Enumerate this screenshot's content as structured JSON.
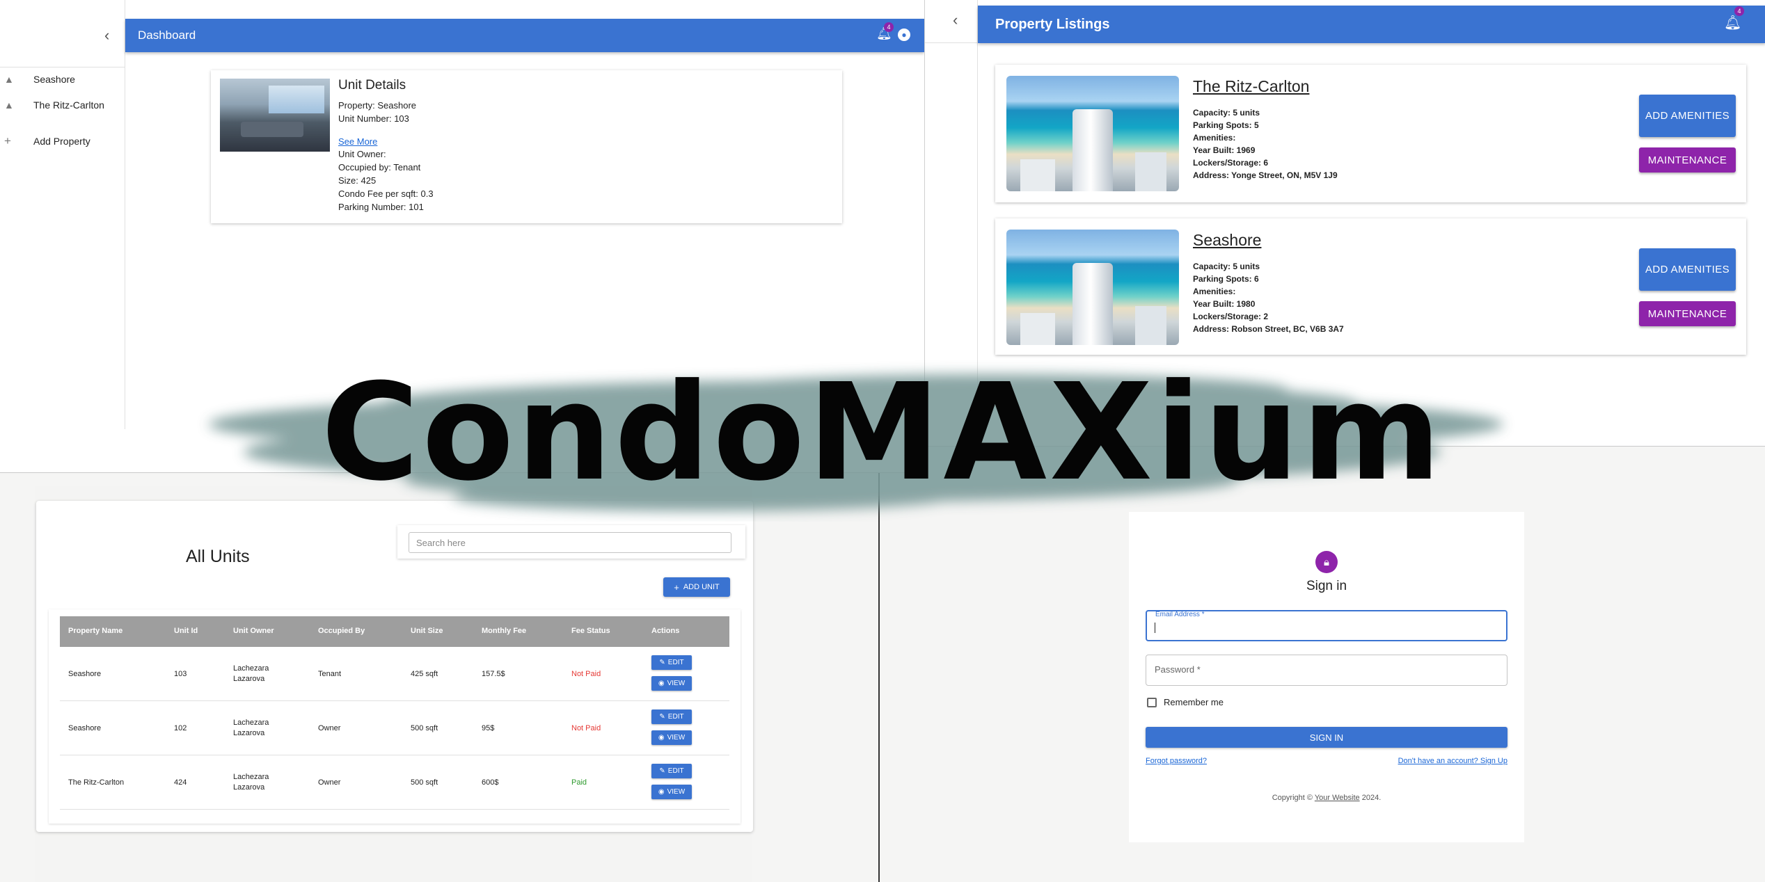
{
  "dashboard": {
    "drawer_items": [
      {
        "label": "Seashore",
        "icon": "buildings-icon"
      },
      {
        "label": "The Ritz-Carlton",
        "icon": "buildings-icon"
      },
      {
        "label": "Add Property",
        "icon": "plus-icon"
      }
    ],
    "title": "Dashboard",
    "notification_count": "4",
    "unit_card": {
      "title": "Unit Details",
      "property": "Property: Seashore",
      "unit_number": "Unit Number: 103",
      "see_more": "See More",
      "unit_owner": "Unit Owner:",
      "occupied_by": "Occupied by: Tenant",
      "size": "Size: 425",
      "condo_fee": "Condo Fee per sqft: 0.3",
      "parking": "Parking Number: 101"
    }
  },
  "listings": {
    "title": "Property Listings",
    "notification_count": "4",
    "properties": [
      {
        "name": "The Ritz-Carlton",
        "capacity": "Capacity: 5 units",
        "parking": "Parking Spots: 5",
        "amenities": "Amenities:",
        "year": "Year Built: 1969",
        "lockers": "Lockers/Storage: 6",
        "address": "Address: Yonge Street, ON, M5V 1J9",
        "add_amenities": "ADD AMENITIES",
        "maintenance": "MAINTENANCE"
      },
      {
        "name": "Seashore",
        "capacity": "Capacity: 5 units",
        "parking": "Parking Spots: 6",
        "amenities": "Amenities:",
        "year": "Year Built: 1980",
        "lockers": "Lockers/Storage: 2",
        "address": "Address: Robson Street, BC, V6B 3A7",
        "add_amenities": "ADD AMENITIES",
        "maintenance": "MAINTENANCE"
      }
    ]
  },
  "units": {
    "title": "All Units",
    "search_placeholder": "Search here",
    "add_unit": "ADD UNIT",
    "columns": [
      "Property Name",
      "Unit Id",
      "Unit Owner",
      "Occupied By",
      "Unit Size",
      "Monthly Fee",
      "Fee Status",
      "Actions"
    ],
    "rows": [
      {
        "property": "Seashore",
        "unit_id": "103",
        "owner_first": "Lachezara",
        "owner_last": "Lazarova",
        "occupied": "Tenant",
        "size": "425 sqft",
        "fee": "157.5$",
        "status": "Not Paid",
        "status_color": "#e53935"
      },
      {
        "property": "Seashore",
        "unit_id": "102",
        "owner_first": "Lachezara",
        "owner_last": "Lazarova",
        "occupied": "Owner",
        "size": "500 sqft",
        "fee": "95$",
        "status": "Not Paid",
        "status_color": "#e53935"
      },
      {
        "property": "The Ritz-Carlton",
        "unit_id": "424",
        "owner_first": "Lachezara",
        "owner_last": "Lazarova",
        "occupied": "Owner",
        "size": "500 sqft",
        "fee": "600$",
        "status": "Paid",
        "status_color": "#2e9a2e"
      }
    ],
    "edit_label": "EDIT",
    "view_label": "VIEW"
  },
  "signin": {
    "title": "Sign in",
    "email_label": "Email Address *",
    "password_label": "Password *",
    "remember": "Remember me",
    "button": "SIGN IN",
    "forgot": "Forgot password?",
    "signup": "Don't have an account? Sign Up",
    "copyright_prefix": "Copyright ©",
    "copyright_link": "Your Website",
    "copyright_year": "2024."
  },
  "brand": {
    "logo": "CondoMAXium",
    "brush_color": "#7a9a99"
  },
  "colors": {
    "primary": "#3a73d1",
    "secondary": "#8e24aa"
  }
}
